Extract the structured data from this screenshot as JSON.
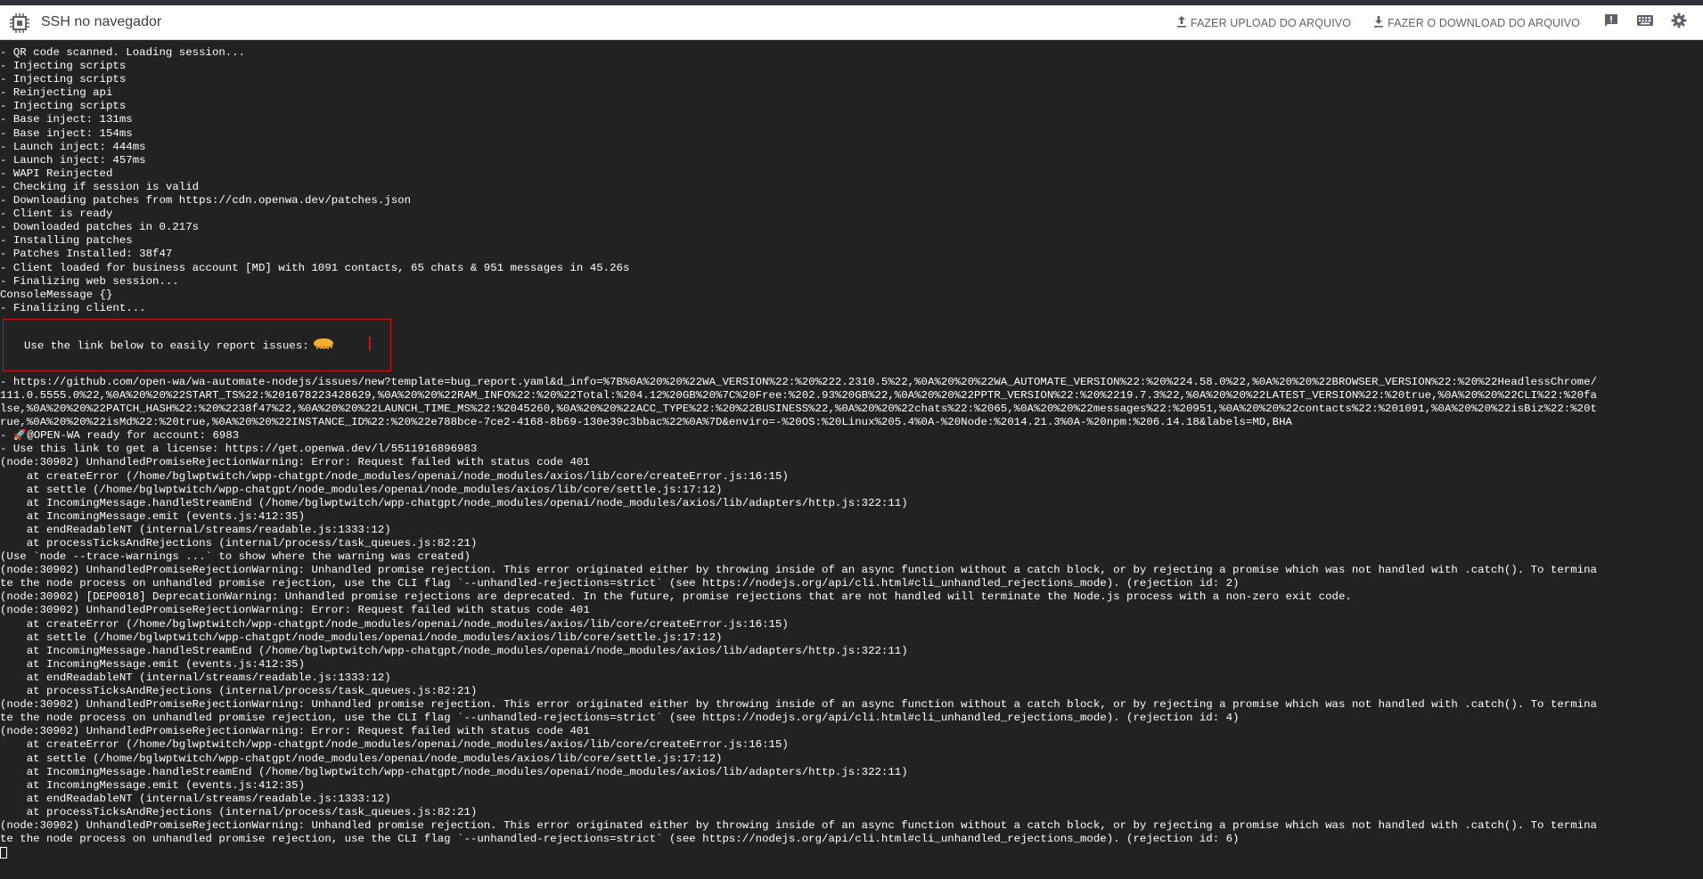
{
  "header": {
    "title": "SSH no navegador",
    "upload_label": "FAZER UPLOAD DO ARQUIVO",
    "download_label": "FAZER O DOWNLOAD DO ARQUIVO",
    "icons": [
      "chip-logo-icon",
      "upload-icon",
      "download-icon",
      "feedback-icon",
      "keyboard-icon",
      "settings-icon"
    ]
  },
  "terminal": {
    "lines_top": [
      "- QR code scanned. Loading session...",
      "- Injecting scripts",
      "- Injecting scripts",
      "- Reinjecting api",
      "- Injecting scripts",
      "- Base inject: 131ms",
      "- Base inject: 154ms",
      "- Launch inject: 444ms",
      "- Launch inject: 457ms",
      "- WAPI Reinjected",
      "- Checking if session is valid",
      "- Downloading patches from https://cdn.openwa.dev/patches.json",
      "- Client is ready",
      "- Downloaded patches in 0.217s",
      "- Installing patches",
      "- Patches Installed: 38f47",
      "- Client loaded for business account [MD] with 1091 contacts, 65 chats & 951 messages in 45.26s",
      "- Finalizing web session...",
      "ConsoleMessage {}",
      "- Finalizing client..."
    ],
    "report_text": "Use the link below to easily report issues:",
    "lines_bottom": [
      "- https://github.com/open-wa/wa-automate-nodejs/issues/new?template=bug_report.yaml&d_info=%7B%0A%20%20%22WA_VERSION%22:%20%222.2310.5%22,%0A%20%20%22WA_AUTOMATE_VERSION%22:%20%224.58.0%22,%0A%20%20%22BROWSER_VERSION%22:%20%22HeadlessChrome/",
      "111.0.5555.0%22,%0A%20%20%22START_TS%22:%201678223428629,%0A%20%20%22RAM_INFO%22:%20%22Total:%204.12%20GB%20%7C%20Free:%202.93%20GB%22,%0A%20%20%22PPTR_VERSION%22:%20%2219.7.3%22,%0A%20%20%22LATEST_VERSION%22:%20true,%0A%20%20%22CLI%22:%20fa",
      "lse,%0A%20%20%22PATCH_HASH%22:%20%2238f47%22,%0A%20%20%22LAUNCH_TIME_MS%22:%2045260,%0A%20%20%22ACC_TYPE%22:%20%22BUSINESS%22,%0A%20%20%22chats%22:%2065,%0A%20%20%22messages%22:%20951,%0A%20%20%22contacts%22:%201091,%0A%20%20%22isBiz%22:%20t",
      "rue,%0A%20%20%22isMd%22:%20true,%0A%20%20%22INSTANCE_ID%22:%20%22e788bce-7ce2-4168-8b69-130e39c3bbac%22%0A%7D&enviro=-%20OS:%20Linux%205.4%0A-%20Node:%2014.21.3%0A-%20npm:%206.14.18&labels=MD,BHA",
      "- 🚀@OPEN-WA ready for account: 6983",
      "- Use this link to get a license: https://get.openwa.dev/l/5511916896983",
      "(node:30902) UnhandledPromiseRejectionWarning: Error: Request failed with status code 401",
      "    at createError (/home/bglwptwitch/wpp-chatgpt/node_modules/openai/node_modules/axios/lib/core/createError.js:16:15)",
      "    at settle (/home/bglwptwitch/wpp-chatgpt/node_modules/openai/node_modules/axios/lib/core/settle.js:17:12)",
      "    at IncomingMessage.handleStreamEnd (/home/bglwptwitch/wpp-chatgpt/node_modules/openai/node_modules/axios/lib/adapters/http.js:322:11)",
      "    at IncomingMessage.emit (events.js:412:35)",
      "    at endReadableNT (internal/streams/readable.js:1333:12)",
      "    at processTicksAndRejections (internal/process/task_queues.js:82:21)",
      "(Use `node --trace-warnings ...` to show where the warning was created)",
      "(node:30902) UnhandledPromiseRejectionWarning: Unhandled promise rejection. This error originated either by throwing inside of an async function without a catch block, or by rejecting a promise which was not handled with .catch(). To termina",
      "te the node process on unhandled promise rejection, use the CLI flag `--unhandled-rejections=strict` (see https://nodejs.org/api/cli.html#cli_unhandled_rejections_mode). (rejection id: 2)",
      "(node:30902) [DEP0018] DeprecationWarning: Unhandled promise rejections are deprecated. In the future, promise rejections that are not handled will terminate the Node.js process with a non-zero exit code.",
      "(node:30902) UnhandledPromiseRejectionWarning: Error: Request failed with status code 401",
      "    at createError (/home/bglwptwitch/wpp-chatgpt/node_modules/openai/node_modules/axios/lib/core/createError.js:16:15)",
      "    at settle (/home/bglwptwitch/wpp-chatgpt/node_modules/openai/node_modules/axios/lib/core/settle.js:17:12)",
      "    at IncomingMessage.handleStreamEnd (/home/bglwptwitch/wpp-chatgpt/node_modules/openai/node_modules/axios/lib/adapters/http.js:322:11)",
      "    at IncomingMessage.emit (events.js:412:35)",
      "    at endReadableNT (internal/streams/readable.js:1333:12)",
      "    at processTicksAndRejections (internal/process/task_queues.js:82:21)",
      "(node:30902) UnhandledPromiseRejectionWarning: Unhandled promise rejection. This error originated either by throwing inside of an async function without a catch block, or by rejecting a promise which was not handled with .catch(). To termina",
      "te the node process on unhandled promise rejection, use the CLI flag `--unhandled-rejections=strict` (see https://nodejs.org/api/cli.html#cli_unhandled_rejections_mode). (rejection id: 4)",
      "(node:30902) UnhandledPromiseRejectionWarning: Error: Request failed with status code 401",
      "    at createError (/home/bglwptwitch/wpp-chatgpt/node_modules/openai/node_modules/axios/lib/core/createError.js:16:15)",
      "    at settle (/home/bglwptwitch/wpp-chatgpt/node_modules/openai/node_modules/axios/lib/core/settle.js:17:12)",
      "    at IncomingMessage.handleStreamEnd (/home/bglwptwitch/wpp-chatgpt/node_modules/openai/node_modules/axios/lib/adapters/http.js:322:11)",
      "    at IncomingMessage.emit (events.js:412:35)",
      "    at endReadableNT (internal/streams/readable.js:1333:12)",
      "    at processTicksAndRejections (internal/process/task_queues.js:82:21)",
      "(node:30902) UnhandledPromiseRejectionWarning: Unhandled promise rejection. This error originated either by throwing inside of an async function without a catch block, or by rejecting a promise which was not handled with .catch(). To termina",
      "te the node process on unhandled promise rejection, use the CLI flag `--unhandled-rejections=strict` (see https://nodejs.org/api/cli.html#cli_unhandled_rejections_mode). (rejection id: 6)"
    ]
  },
  "colors": {
    "terminal_bg": "#222222",
    "terminal_fg": "#ffffff",
    "report_border": "#c8161d",
    "header_bg": "#ffffff",
    "header_fg": "#5f6368"
  }
}
